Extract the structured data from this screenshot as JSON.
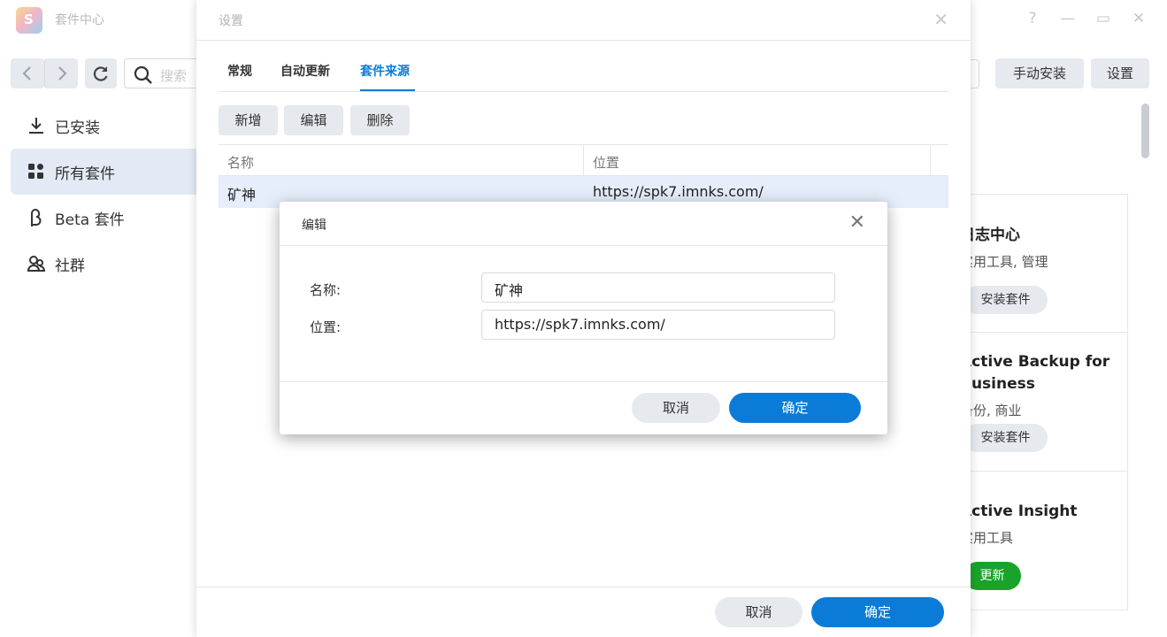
{
  "app": {
    "title": "套件中心",
    "logo_letter": "S",
    "window_controls": [
      "?",
      "—",
      "▭",
      "✕"
    ]
  },
  "toolbar": {
    "search_placeholder": "搜索",
    "manual_install_label": "手动安装",
    "settings_label": "设置"
  },
  "sidebar": {
    "items": [
      {
        "label": "已安装",
        "icon": "download-icon"
      },
      {
        "label": "所有套件",
        "icon": "grid-icon",
        "active": true
      },
      {
        "label": "Beta 套件",
        "icon": "beta-icon"
      },
      {
        "label": "社群",
        "icon": "community-icon"
      }
    ]
  },
  "cards": [
    {
      "name": "日志中心",
      "category": "实用工具, 管理",
      "action": "安装套件"
    },
    {
      "name": "Active Backup for Business",
      "category": "备份, 商业",
      "action": "安装套件"
    },
    {
      "name": "Active Insight",
      "category": "实用工具",
      "action": "更新"
    }
  ],
  "settings_dialog": {
    "title": "设置",
    "tabs": [
      {
        "label": "常规"
      },
      {
        "label": "自动更新"
      },
      {
        "label": "套件来源",
        "active": true
      }
    ],
    "actions": {
      "add": "新增",
      "edit": "编辑",
      "delete": "删除"
    },
    "columns": {
      "name": "名称",
      "location": "位置"
    },
    "rows": [
      {
        "name": "矿神",
        "location": "https://spk7.imnks.com/"
      }
    ],
    "cancel_label": "取消",
    "ok_label": "确定"
  },
  "edit_dialog": {
    "title": "编辑",
    "name_label": "名称:",
    "name_value": "矿神",
    "location_label": "位置:",
    "location_value": "https://spk7.imnks.com/",
    "cancel_label": "取消",
    "ok_label": "确定"
  },
  "colors": {
    "accent": "#0a7bd7",
    "update_green": "#1aa32a",
    "selected_row": "#e5eefa"
  }
}
